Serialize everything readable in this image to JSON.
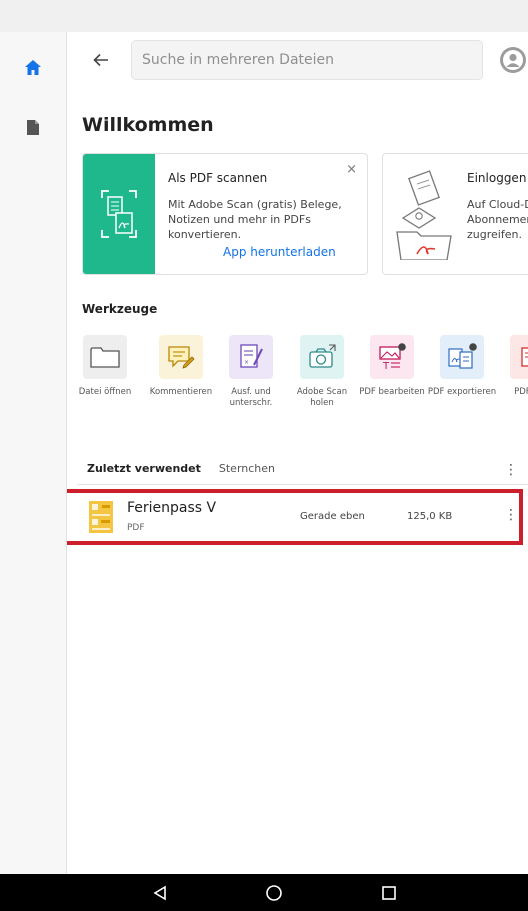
{
  "search": {
    "placeholder": "Suche in mehreren Dateien"
  },
  "welcome": {
    "title": "Willkommen"
  },
  "cards": [
    {
      "title": "Als PDF scannen",
      "body": "Mit Adobe Scan (gratis) Belege, Notizen und mehr in PDFs konvertieren.",
      "link": "App herunterladen",
      "close": "×"
    },
    {
      "title": "Einloggen u",
      "body": "Auf Cloud-D Abonnemen zugreifen."
    }
  ],
  "tools": {
    "title": "Werkzeuge",
    "items": [
      {
        "label": "Datei öffnen",
        "icon": "folder-icon",
        "color": "#eeeeee"
      },
      {
        "label": "Kommentieren",
        "icon": "comment-icon",
        "color": "#fbf3d9"
      },
      {
        "label": "Ausf. und unterschr.",
        "icon": "fill-sign-icon",
        "color": "#ede6f9"
      },
      {
        "label": "Adobe Scan holen",
        "icon": "camera-icon",
        "color": "#dff3f3"
      },
      {
        "label": "PDF bearbeiten",
        "icon": "edit-pdf-icon",
        "color": "#fce6ef"
      },
      {
        "label": "PDF exportieren",
        "icon": "export-pdf-icon",
        "color": "#e3eefb"
      },
      {
        "label": "PDF erst",
        "icon": "create-pdf-icon",
        "color": "#fde6e6"
      }
    ]
  },
  "recent": {
    "tab_active": "Zuletzt verwendet",
    "tab_other": "Sternchen",
    "more": "⋮",
    "files": [
      {
        "name": "Ferienpass V",
        "type": "PDF",
        "date": "Gerade eben",
        "size": "125,0 KB",
        "more": "⋮"
      }
    ]
  },
  "colors": {
    "accent": "#1473e6",
    "scan_band": "#1eb88c",
    "highlight": "#cc1f2b"
  }
}
